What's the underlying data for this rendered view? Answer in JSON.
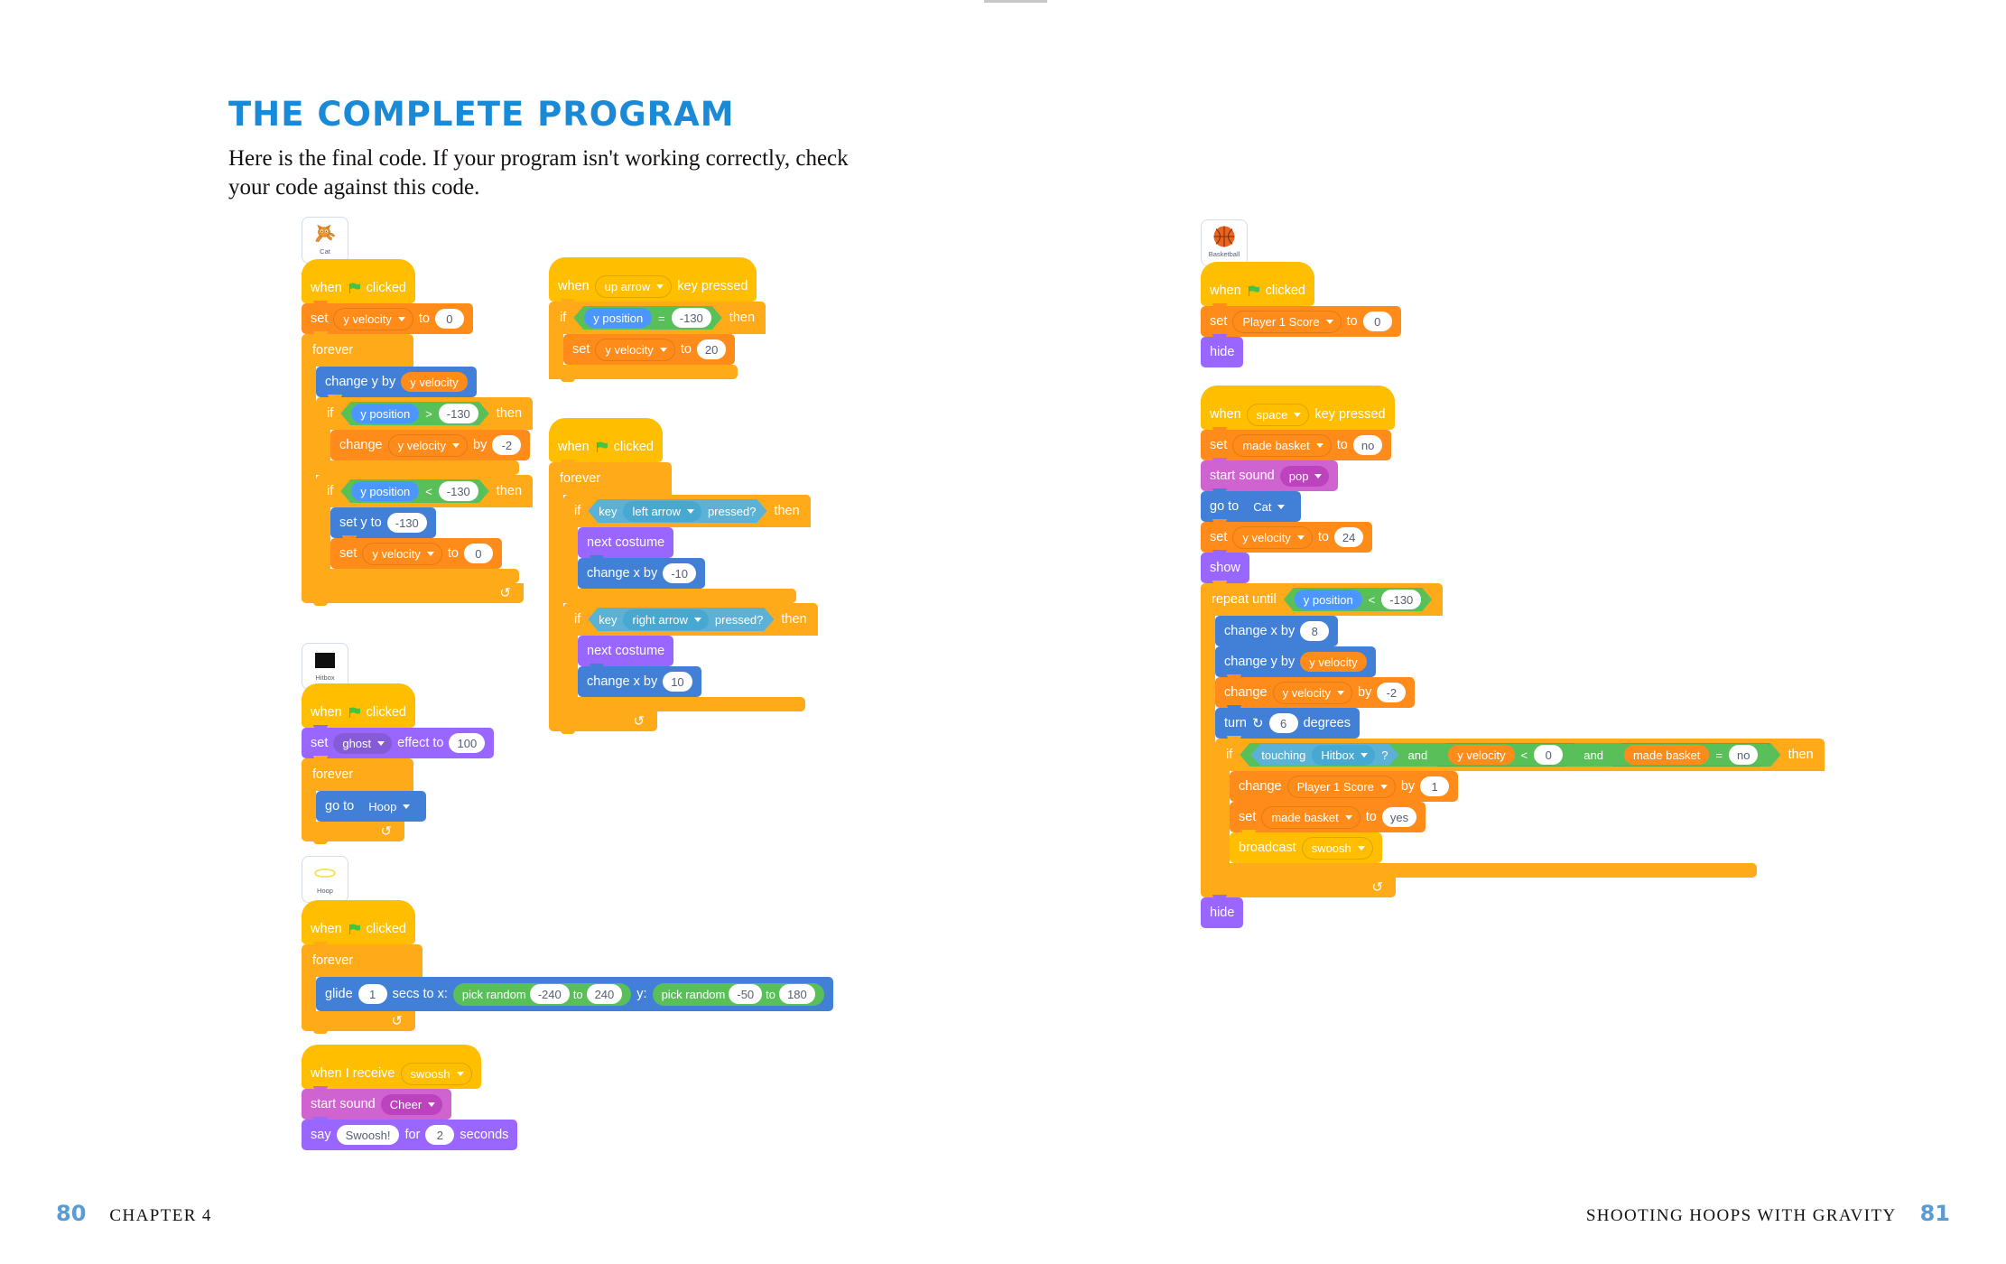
{
  "page": {
    "heading": "The Complete Program",
    "lede": "Here is the final code. If your program isn't working correctly, check your code against this code.",
    "footer_left_num": "80",
    "footer_left_text": "CHAPTER 4",
    "footer_right_text": "SHOOTING HOOPS WITH GRAVITY",
    "footer_right_num": "81",
    "accent_color": "#1b8ad6",
    "folio_color": "#5b9bd5"
  },
  "sprites": {
    "cat": {
      "name": "Cat",
      "icon": "cat-sprite-icon"
    },
    "hitbox": {
      "name": "Hitbox",
      "icon": "black-square-icon"
    },
    "hoop": {
      "name": "Hoop",
      "icon": "hoop-ellipse-icon"
    },
    "basketball": {
      "name": "Basketball",
      "icon": "basketball-icon"
    }
  },
  "labels": {
    "when": "when",
    "clicked": "clicked",
    "key_pressed": "key pressed",
    "when_i_receive": "when I receive",
    "set": "set",
    "to": "to",
    "by": "by",
    "change": "change",
    "forever": "forever",
    "if": "if",
    "then": "then",
    "and": "and",
    "repeat_until": "repeat until",
    "key": "key",
    "pressed_q": "pressed?",
    "touching": "touching",
    "question": "?",
    "next_costume": "next costume",
    "change_y_by": "change y by",
    "change_x_by": "change x by",
    "set_y_to": "set y to",
    "go_to": "go to",
    "show": "show",
    "hide": "hide",
    "start_sound": "start sound",
    "broadcast": "broadcast",
    "say": "say",
    "for": "for",
    "seconds": "seconds",
    "glide": "glide",
    "secs_to_x": "secs to x:",
    "y_colon": "y:",
    "pick_random": "pick random",
    "effect_to": "effect to",
    "turn": "turn",
    "degrees": "degrees"
  },
  "vars": {
    "y_velocity": "y velocity",
    "y_position": "y position",
    "player1_score": "Player 1 Score",
    "made_basket": "made basket"
  },
  "scripts": {
    "cat_main": {
      "title": "cat-gravity-script",
      "hat": {
        "when": "when",
        "clicked": "clicked"
      },
      "set_yvel": {
        "set": "set",
        "var": "y velocity",
        "to": "to",
        "value": "0"
      },
      "forever": "forever",
      "change_y": {
        "label": "change y by",
        "value": "y velocity"
      },
      "if1": {
        "if": "if",
        "left": "y position",
        "op": ">",
        "right": "-130",
        "then": "then"
      },
      "if1_body": {
        "change": "change",
        "var": "y velocity",
        "by": "by",
        "value": "-2"
      },
      "if2": {
        "if": "if",
        "left": "y position",
        "op": "<",
        "right": "-130",
        "then": "then"
      },
      "if2_sety": {
        "label": "set y to",
        "value": "-130"
      },
      "if2_setvel": {
        "set": "set",
        "var": "y velocity",
        "to": "to",
        "value": "0"
      }
    },
    "cat_uparrow": {
      "title": "cat-up-arrow-script",
      "hat": {
        "when": "when",
        "key": "up arrow",
        "suffix": "key pressed"
      },
      "if": {
        "if": "if",
        "left": "y position",
        "op": "=",
        "right": "-130",
        "then": "then"
      },
      "set_yvel": {
        "set": "set",
        "var": "y velocity",
        "to": "to",
        "value": "20"
      }
    },
    "cat_arrows": {
      "title": "cat-left-right-script",
      "hat": {
        "when": "when",
        "clicked": "clicked"
      },
      "forever": "forever",
      "if_left": {
        "if": "if",
        "key": "key",
        "value": "left arrow",
        "pressed": "pressed?",
        "then": "then"
      },
      "left_next_costume": "next costume",
      "left_change_x": {
        "label": "change x by",
        "value": "-10"
      },
      "if_right": {
        "if": "if",
        "key": "key",
        "value": "right arrow",
        "pressed": "pressed?",
        "then": "then"
      },
      "right_next_costume": "next costume",
      "right_change_x": {
        "label": "change x by",
        "value": "10"
      }
    },
    "hitbox": {
      "title": "hitbox-script",
      "hat": {
        "when": "when",
        "clicked": "clicked"
      },
      "set_ghost": {
        "set": "set",
        "effect": "ghost",
        "effect_to": "effect to",
        "value": "100"
      },
      "forever": "forever",
      "go_to": {
        "label": "go to",
        "value": "Hoop"
      }
    },
    "hoop": {
      "title": "hoop-script",
      "hat": {
        "when": "when",
        "clicked": "clicked"
      },
      "forever": "forever",
      "glide": {
        "glide": "glide",
        "secs": "1",
        "secs_to_x": "secs to x:",
        "rand1": {
          "label": "pick random",
          "from": "-240",
          "to": "to",
          "until": "240"
        },
        "y_colon": "y:",
        "rand2": {
          "label": "pick random",
          "from": "-50",
          "to": "to",
          "until": "180"
        }
      }
    },
    "cat_swoosh": {
      "title": "cat-swoosh-script",
      "hat": {
        "label": "when I receive",
        "value": "swoosh"
      },
      "start_sound": {
        "label": "start sound",
        "value": "Cheer"
      },
      "say": {
        "label": "say",
        "text": "Swoosh!",
        "for": "for",
        "secs": "2",
        "seconds": "seconds"
      }
    },
    "ball_init": {
      "title": "basketball-init-script",
      "hat": {
        "when": "when",
        "clicked": "clicked"
      },
      "set_score": {
        "set": "set",
        "var": "Player 1 Score",
        "to": "to",
        "value": "0"
      },
      "hide": "hide"
    },
    "ball_shoot": {
      "title": "basketball-shoot-script",
      "hat": {
        "when": "when",
        "key": "space",
        "suffix": "key pressed"
      },
      "set_made": {
        "set": "set",
        "var": "made basket",
        "to": "to",
        "value": "no"
      },
      "start_sound": {
        "label": "start sound",
        "value": "pop"
      },
      "go_to": {
        "label": "go to",
        "value": "Cat"
      },
      "set_yvel": {
        "set": "set",
        "var": "y velocity",
        "to": "to",
        "value": "24"
      },
      "show": "show",
      "repeat_until": {
        "label": "repeat until",
        "left": "y position",
        "op": "<",
        "right": "-130"
      },
      "change_x": {
        "label": "change x by",
        "value": "8"
      },
      "change_y": {
        "label": "change y by",
        "value": "y velocity"
      },
      "change_yvel": {
        "change": "change",
        "var": "y velocity",
        "by": "by",
        "value": "-2"
      },
      "turn": {
        "label": "turn",
        "value": "6",
        "degrees": "degrees"
      },
      "if": {
        "if": "if",
        "touching": "touching",
        "touching_val": "Hitbox",
        "q": "?",
        "and1": "and",
        "left2": "y velocity",
        "op2": "<",
        "right2": "0",
        "and2": "and",
        "left3": "made basket",
        "op3": "=",
        "right3": "no",
        "then": "then"
      },
      "change_score": {
        "change": "change",
        "var": "Player 1 Score",
        "by": "by",
        "value": "1"
      },
      "set_made_yes": {
        "set": "set",
        "var": "made basket",
        "to": "to",
        "value": "yes"
      },
      "broadcast": {
        "label": "broadcast",
        "value": "swoosh"
      },
      "hide": "hide"
    }
  }
}
